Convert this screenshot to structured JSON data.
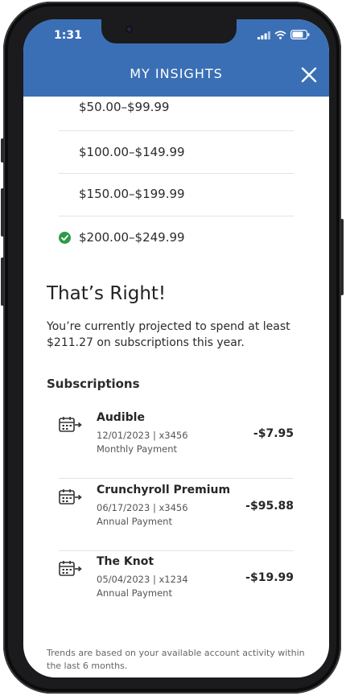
{
  "status_bar": {
    "time": "1:31"
  },
  "header": {
    "title": "MY INSIGHTS",
    "close_icon": "close-icon",
    "background": "#3a6fb5"
  },
  "answer_options": [
    {
      "label": "$50.00–$99.99",
      "selected": false
    },
    {
      "label": "$100.00–$149.99",
      "selected": false
    },
    {
      "label": "$150.00–$199.99",
      "selected": false
    },
    {
      "label": "$200.00–$249.99",
      "selected": true
    }
  ],
  "result": {
    "title": "That’s Right!",
    "text": "You’re currently projected to spend at least $211.27 on subscriptions this year."
  },
  "subscriptions": {
    "title": "Subscriptions",
    "items": [
      {
        "name": "Audible",
        "meta": "12/01/2023 | x3456",
        "frequency": "Monthly Payment",
        "amount": "-$7.95",
        "icon": "calendar-arrow-icon"
      },
      {
        "name": "Crunchyroll Premium",
        "meta": "06/17/2023 | x3456",
        "frequency": "Annual Payment",
        "amount": "-$95.88",
        "icon": "calendar-arrow-icon"
      },
      {
        "name": "The Knot",
        "meta": "05/04/2023 | x1234",
        "frequency": "Annual Payment",
        "amount": "-$19.99",
        "icon": "calendar-arrow-icon"
      }
    ]
  },
  "footnote": "Trends are based on your available account activity within the last 6 months.",
  "colors": {
    "accent": "#3a6fb5",
    "success": "#2e9a47"
  }
}
